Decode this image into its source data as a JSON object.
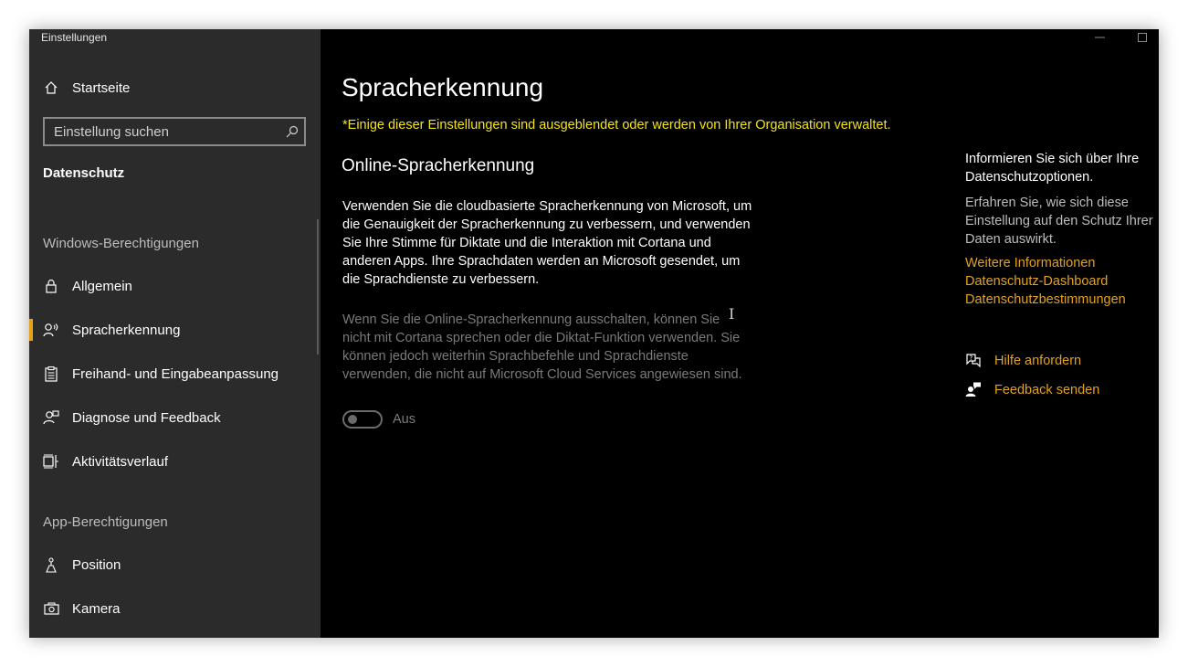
{
  "colors": {
    "accent": "#e3a21a",
    "warning_text": "#f2e31a",
    "link": "#e3a21a"
  },
  "window": {
    "title": "Einstellungen",
    "minimize_icon": "minimize-icon",
    "maximize_icon": "maximize-icon"
  },
  "sidebar": {
    "home": {
      "label": "Startseite",
      "icon": "home-icon"
    },
    "search": {
      "placeholder": "Einstellung suchen",
      "icon": "search-icon"
    },
    "category": "Datenschutz",
    "sections": [
      {
        "heading": "Windows-Berechtigungen",
        "items": [
          {
            "label": "Allgemein",
            "icon": "lock-icon"
          },
          {
            "label": "Spracherkennung",
            "icon": "speech-icon",
            "selected": true
          },
          {
            "label": "Freihand- und Eingabeanpassung",
            "icon": "clipboard-icon"
          },
          {
            "label": "Diagnose und Feedback",
            "icon": "diagnostics-icon"
          },
          {
            "label": "Aktivitätsverlauf",
            "icon": "timeline-icon"
          }
        ]
      },
      {
        "heading": "App-Berechtigungen",
        "items": [
          {
            "label": "Position",
            "icon": "location-icon"
          },
          {
            "label": "Kamera",
            "icon": "camera-icon"
          }
        ]
      }
    ]
  },
  "main": {
    "title": "Spracherkennung",
    "org_note": "*Einige dieser Einstellungen sind ausgeblendet oder werden von Ihrer Organisation verwaltet.",
    "subtitle": "Online-Spracherkennung",
    "description": "Verwenden Sie die cloudbasierte Spracherkennung von Microsoft, um die Genauigkeit der Spracherkennung zu verbessern, und verwenden Sie Ihre Stimme für Diktate und die Interaktion mit Cortana und anderen Apps. Ihre Sprachdaten werden an Microsoft gesendet, um die Sprachdienste zu verbessern.",
    "description_disabled": "Wenn Sie die Online-Spracherkennung ausschalten, können Sie nicht mit Cortana sprechen oder die Diktat-Funktion verwenden. Sie können jedoch weiterhin Sprachbefehle und Sprachdienste verwenden, die nicht auf Microsoft Cloud Services angewiesen sind.",
    "toggle": {
      "state": "Aus",
      "on": false,
      "disabled": true
    }
  },
  "right_panel": {
    "info_title": "Informieren Sie sich über Ihre Datenschutzoptionen.",
    "info_body": "Erfahren Sie, wie sich diese Einstellung auf den Schutz Ihrer Daten auswirkt.",
    "links": [
      "Weitere Informationen",
      "Datenschutz-Dashboard",
      "Datenschutzbestimmungen"
    ],
    "help": {
      "label": "Hilfe anfordern",
      "icon": "help-chat-icon"
    },
    "feedback": {
      "label": "Feedback senden",
      "icon": "feedback-icon"
    }
  }
}
